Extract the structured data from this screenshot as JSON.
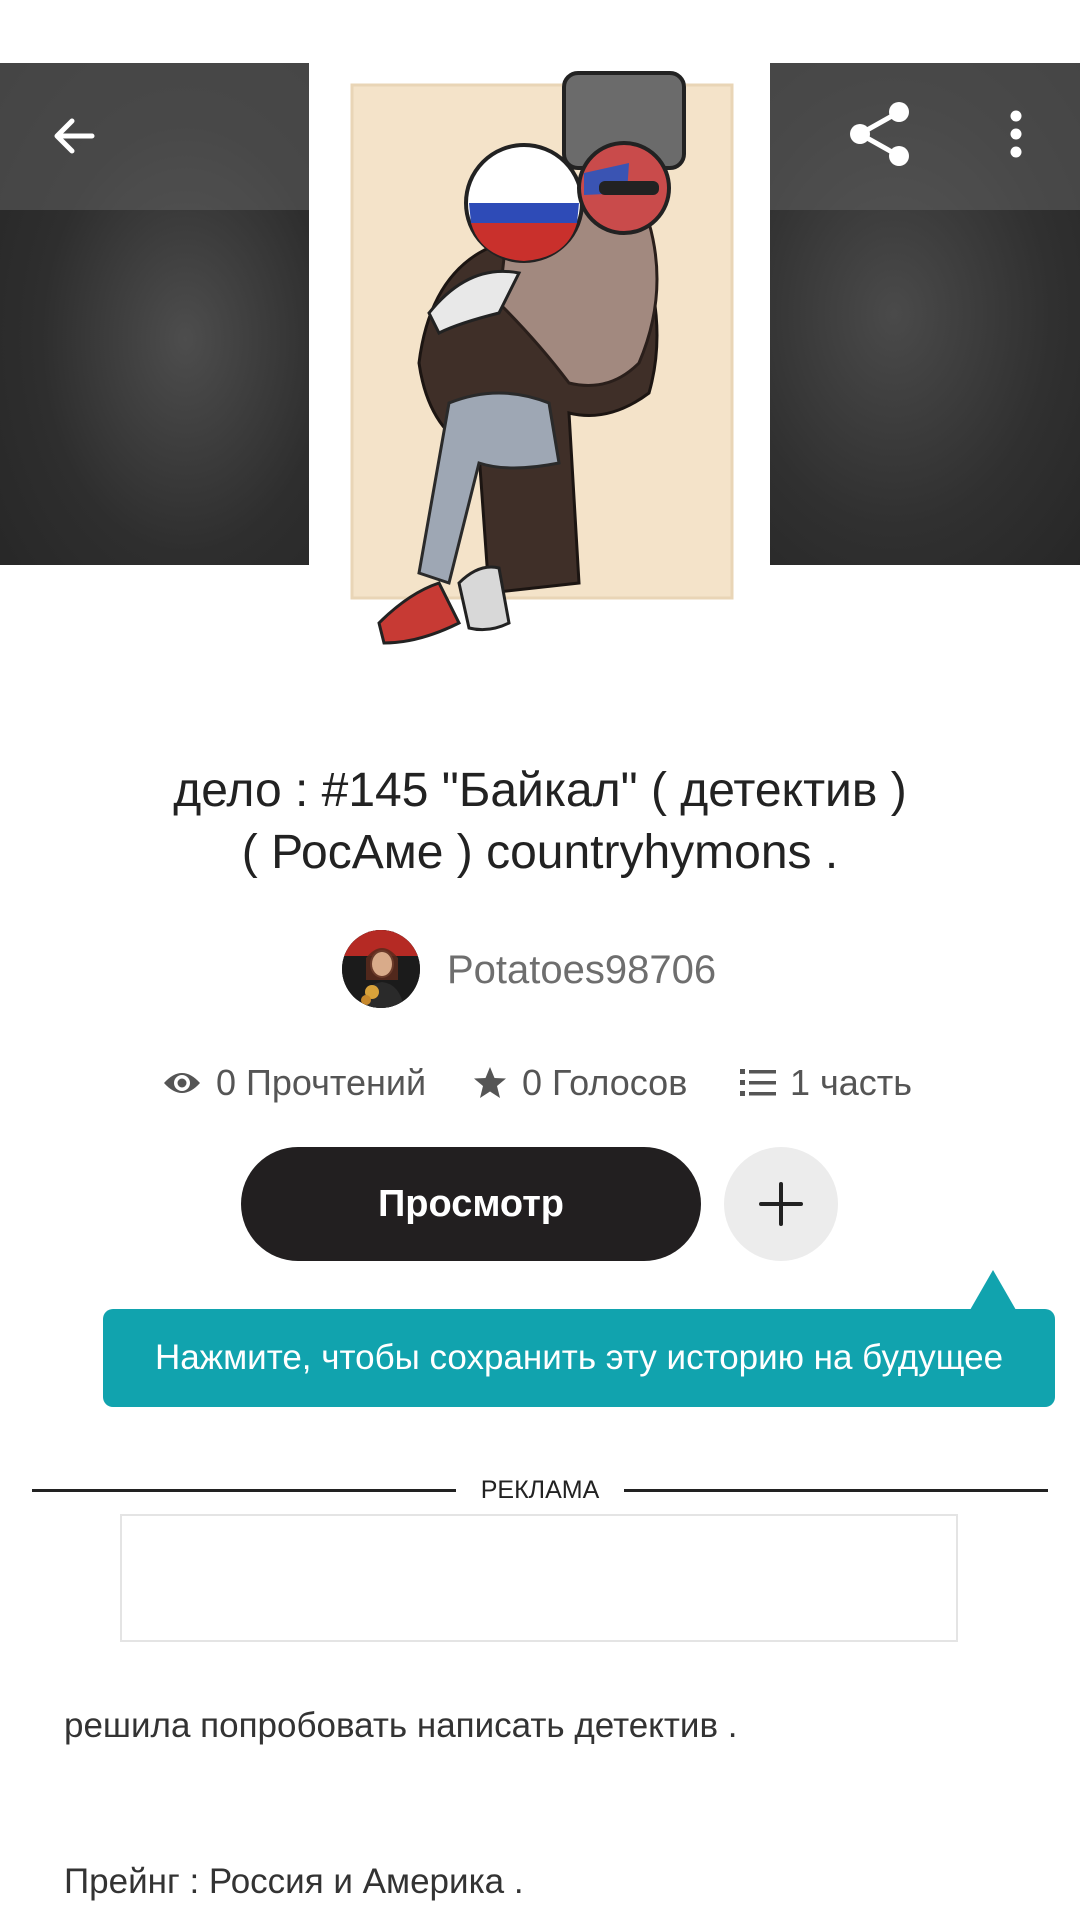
{
  "story": {
    "title_line1": "дело : #145 \"Байкал\" ( детектив )",
    "title_line2": "( РосАме ) countryhymons .",
    "author": "Potatoes98706"
  },
  "stats": {
    "reads": "0 Прочтений",
    "votes": "0 Голосов",
    "parts": "1 часть"
  },
  "actions": {
    "read_label": "Просмотр"
  },
  "tooltip": {
    "text": "Нажмите, чтобы сохранить эту историю на будущее"
  },
  "ad": {
    "label": "РЕКЛАМА"
  },
  "description": {
    "line1": "решила попробовать написать детектив .",
    "line2": "Прейнг : Россия и Америка ."
  },
  "icons": {
    "back": "arrow-left-icon",
    "share": "share-icon",
    "more": "more-vertical-icon",
    "reads": "eye-icon",
    "votes": "star-icon",
    "parts": "list-icon",
    "add": "plus-icon"
  },
  "colors": {
    "primary_button": "#221f20",
    "tooltip": "#11a3ae",
    "add_button": "#ececec"
  }
}
